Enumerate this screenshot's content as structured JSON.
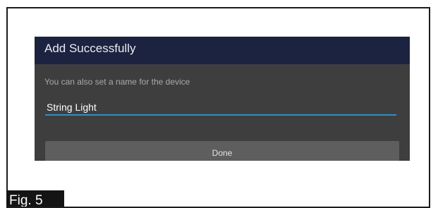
{
  "dialog": {
    "title": "Add Successfully",
    "message": "You can also set a name for the device",
    "name_value": "String Light",
    "done_label": "Done"
  },
  "figure": {
    "label": "Fig. 5"
  },
  "colors": {
    "header": "#1c2340",
    "dialog_body": "#3e3e3e",
    "input_underline": "#2d8fc4",
    "button": "#5e5e5e",
    "figure_label_bg": "#141414"
  }
}
